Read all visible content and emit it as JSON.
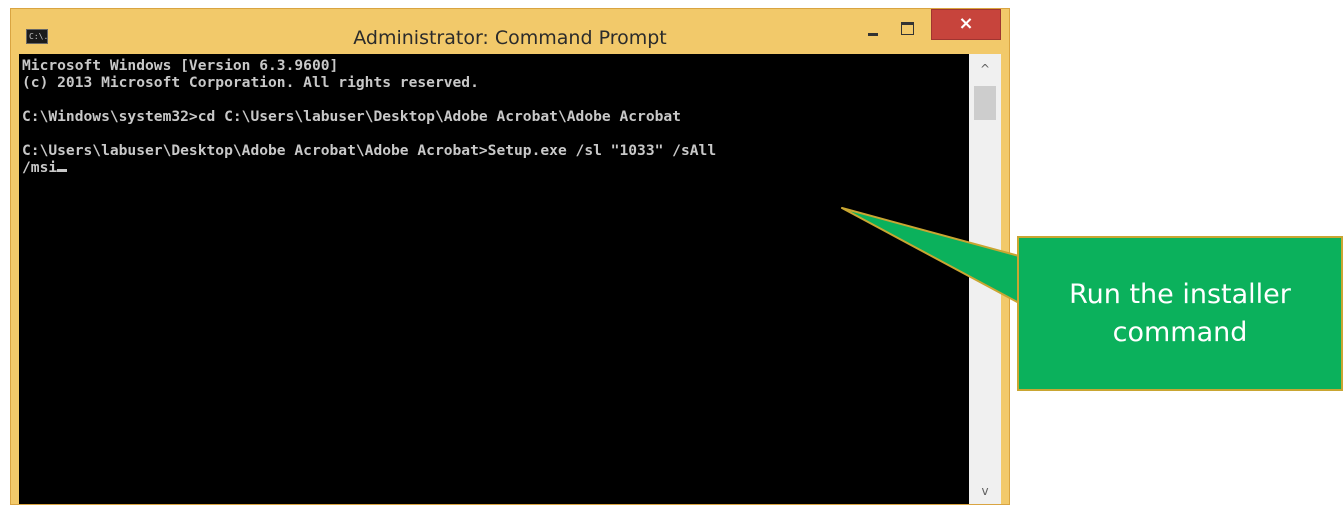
{
  "window": {
    "title": "Administrator: Command Prompt",
    "icon_label": "C:\\.",
    "controls": {
      "minimize_icon": "minimize-icon",
      "maximize_icon": "maximize-icon",
      "close_label": "×"
    },
    "frame_color": "#f2c96a",
    "close_color": "#c7443c"
  },
  "console": {
    "lines": [
      "Microsoft Windows [Version 6.3.9600]",
      "(c) 2013 Microsoft Corporation. All rights reserved.",
      "",
      "C:\\Windows\\system32>cd C:\\Users\\labuser\\Desktop\\Adobe Acrobat\\Adobe Acrobat",
      "",
      "C:\\Users\\labuser\\Desktop\\Adobe Acrobat\\Adobe Acrobat>Setup.exe /sl \"1033\" /sAll",
      "/msi"
    ],
    "background": "#000000",
    "text_color": "#c8c8c8"
  },
  "scrollbar": {
    "up_arrow": "^",
    "down_arrow": "v"
  },
  "callout": {
    "text": "Run the installer command",
    "background": "#0bb15c",
    "border_color": "#c9a632"
  }
}
